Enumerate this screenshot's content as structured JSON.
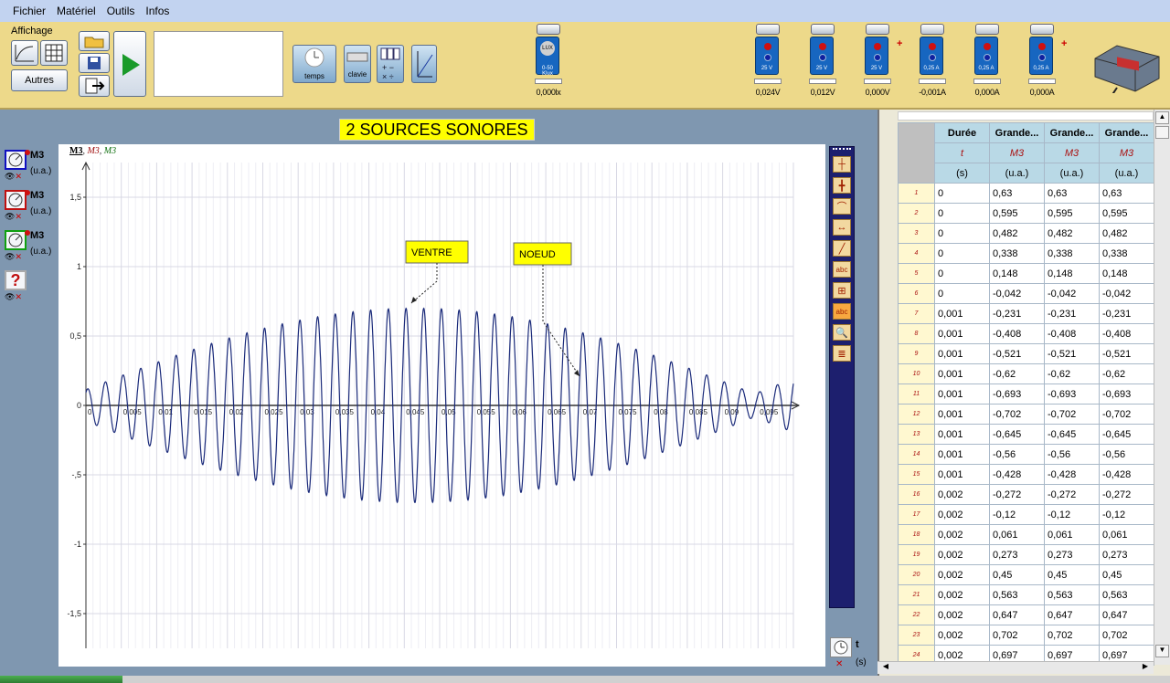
{
  "menu": [
    "Fichier",
    "Matériel",
    "Outils",
    "Infos"
  ],
  "toolbar": {
    "affichage_label": "Affichage",
    "autres_label": "Autres",
    "temps_label": "temps",
    "clavier_label": "clavie"
  },
  "sensors": [
    {
      "label": "0-50 Klux",
      "value": "0,000lx",
      "color": "#1766c0"
    },
    {
      "label": "25 V",
      "value": "0,024V",
      "color": "#1766c0"
    },
    {
      "label": "25 V",
      "value": "0,012V",
      "color": "#1766c0"
    },
    {
      "label": "25 V",
      "value": "0,000V",
      "color": "#1766c0"
    },
    {
      "label": "0,25 A",
      "value": "-0,001A",
      "color": "#1766c0"
    },
    {
      "label": "0,25 A",
      "value": "0,000A",
      "color": "#1766c0"
    },
    {
      "label": "0,25 A",
      "value": "0,000A",
      "color": "#1766c0"
    }
  ],
  "graph": {
    "title": "2 SOURCES SONORES",
    "legend": [
      "M3",
      "M3",
      "M3"
    ],
    "legend_colors": [
      "#1a2a7a",
      "#a01010",
      "#107010"
    ],
    "annotations": [
      {
        "text": "VENTRE"
      },
      {
        "text": "NOEUD"
      }
    ]
  },
  "series_panel": [
    {
      "name": "M3",
      "unit": "(u.a.)",
      "color": "#1010c0"
    },
    {
      "name": "M3",
      "unit": "(u.a.)",
      "color": "#c01010"
    },
    {
      "name": "M3",
      "unit": "(u.a.)",
      "color": "#10a010"
    }
  ],
  "x_axis_label": {
    "name": "t",
    "unit": "(s)"
  },
  "chart_data": {
    "type": "line",
    "title": "2 SOURCES SONORES",
    "xlabel": "",
    "ylabel": "",
    "xlim": [
      0,
      0.1
    ],
    "ylim": [
      -1.75,
      1.75
    ],
    "x_ticks": [
      "0",
      "0,005",
      "0,01",
      "0,015",
      "0,02",
      "0,025",
      "0,03",
      "0,035",
      "0,04",
      "0,045",
      "0,05",
      "0,055",
      "0,06",
      "0,065",
      "0,07",
      "0,075",
      "0,08",
      "0,085",
      "0,09",
      "0,095"
    ],
    "y_ticks": [
      "1,5",
      "1",
      "0,5",
      "0",
      "-,5",
      "-1",
      "-1,5"
    ],
    "grid": true,
    "series": [
      {
        "name": "M3",
        "color": "#1a2a7a",
        "carrier_period_s": 0.0025,
        "beat_node_times_s": [
          0.0225,
          0.0705
        ],
        "beat_antinode_times_s": [
          0.0,
          0.0465,
          0.095
        ],
        "peak_amplitude": 0.7
      }
    ]
  },
  "table": {
    "headers": [
      "Durée",
      "Grande...",
      "Grande...",
      "Grande..."
    ],
    "symbols": [
      "t",
      "M3",
      "M3",
      "M3"
    ],
    "units": [
      "(s)",
      "(u.a.)",
      "(u.a.)",
      "(u.a.)"
    ],
    "rows": [
      [
        "1",
        "0",
        "0,63",
        "0,63",
        "0,63"
      ],
      [
        "2",
        "0",
        "0,595",
        "0,595",
        "0,595"
      ],
      [
        "3",
        "0",
        "0,482",
        "0,482",
        "0,482"
      ],
      [
        "4",
        "0",
        "0,338",
        "0,338",
        "0,338"
      ],
      [
        "5",
        "0",
        "0,148",
        "0,148",
        "0,148"
      ],
      [
        "6",
        "0",
        "-0,042",
        "-0,042",
        "-0,042"
      ],
      [
        "7",
        "0,001",
        "-0,231",
        "-0,231",
        "-0,231"
      ],
      [
        "8",
        "0,001",
        "-0,408",
        "-0,408",
        "-0,408"
      ],
      [
        "9",
        "0,001",
        "-0,521",
        "-0,521",
        "-0,521"
      ],
      [
        "10",
        "0,001",
        "-0,62",
        "-0,62",
        "-0,62"
      ],
      [
        "11",
        "0,001",
        "-0,693",
        "-0,693",
        "-0,693"
      ],
      [
        "12",
        "0,001",
        "-0,702",
        "-0,702",
        "-0,702"
      ],
      [
        "13",
        "0,001",
        "-0,645",
        "-0,645",
        "-0,645"
      ],
      [
        "14",
        "0,001",
        "-0,56",
        "-0,56",
        "-0,56"
      ],
      [
        "15",
        "0,001",
        "-0,428",
        "-0,428",
        "-0,428"
      ],
      [
        "16",
        "0,002",
        "-0,272",
        "-0,272",
        "-0,272"
      ],
      [
        "17",
        "0,002",
        "-0,12",
        "-0,12",
        "-0,12"
      ],
      [
        "18",
        "0,002",
        "0,061",
        "0,061",
        "0,061"
      ],
      [
        "19",
        "0,002",
        "0,273",
        "0,273",
        "0,273"
      ],
      [
        "20",
        "0,002",
        "0,45",
        "0,45",
        "0,45"
      ],
      [
        "21",
        "0,002",
        "0,563",
        "0,563",
        "0,563"
      ],
      [
        "22",
        "0,002",
        "0,647",
        "0,647",
        "0,647"
      ],
      [
        "23",
        "0,002",
        "0,702",
        "0,702",
        "0,702"
      ],
      [
        "24",
        "0,002",
        "0,697",
        "0,697",
        "0,697"
      ]
    ]
  }
}
